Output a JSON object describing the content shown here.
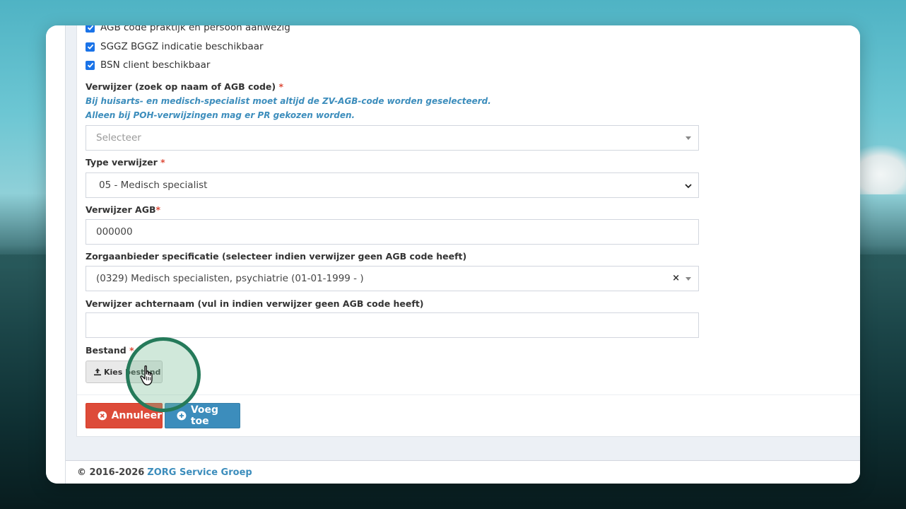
{
  "checks": [
    {
      "label": "AGB code praktijk en persoon aanwezig",
      "checked": true
    },
    {
      "label": "SGGZ BGGZ indicatie beschikbaar",
      "checked": true
    },
    {
      "label": "BSN client beschikbaar",
      "checked": true
    }
  ],
  "verwijzer": {
    "label": "Verwijzer (zoek op naam of AGB code)",
    "required": "*",
    "hint1": "Bij huisarts- en medisch-specialist moet altijd de ZV-AGB-code worden geselecteerd.",
    "hint2": "Alleen bij POH-verwijzingen mag er PR gekozen worden.",
    "placeholder": "Selecteer"
  },
  "type_verwijzer": {
    "label": "Type verwijzer",
    "required": "*",
    "value": "05 - Medisch specialist"
  },
  "verwijzer_agb": {
    "label": "Verwijzer AGB",
    "required": "*",
    "value": "000000"
  },
  "zorgaanbieder": {
    "label": "Zorgaanbieder specificatie (selecteer indien verwijzer geen AGB code heeft)",
    "value": "(0329) Medisch specialisten, psychiatrie (01-01-1999 - )",
    "clear": "×"
  },
  "achternaam": {
    "label": "Verwijzer achternaam (vul in indien verwijzer geen AGB code heeft)",
    "value": ""
  },
  "bestand": {
    "label": "Bestand",
    "required": "*",
    "button": "Kies bestand"
  },
  "actions": {
    "cancel": "Annuleer",
    "add": "Voeg toe"
  },
  "footer": {
    "copyright": "© 2016-2026",
    "company": "ZORG Service Groep"
  },
  "colors": {
    "primary": "#3c8dbc",
    "danger": "#dd4b39",
    "checkbox": "#1a73e8",
    "highlight_ring": "#257a5a"
  }
}
